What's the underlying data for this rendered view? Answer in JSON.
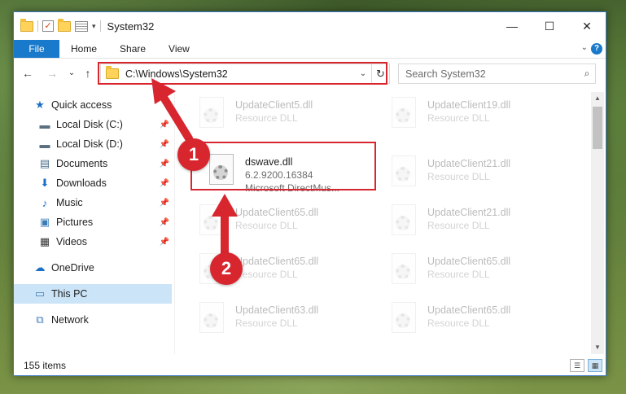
{
  "window": {
    "title": "System32",
    "controls": {
      "minimize": "—",
      "maximize": "☐",
      "close": "✕"
    }
  },
  "ribbon": {
    "tabs": [
      "File",
      "Home",
      "Share",
      "View"
    ],
    "expand_glyph": "⌄",
    "help_glyph": "?"
  },
  "nav": {
    "back_glyph": "←",
    "forward_glyph": "→",
    "recent_glyph": "⌄",
    "up_glyph": "↑"
  },
  "address": {
    "path": "C:\\Windows\\System32",
    "dropdown_glyph": "⌄",
    "refresh_glyph": "↻"
  },
  "search": {
    "placeholder": "Search System32",
    "icon_glyph": "⌕"
  },
  "sidebar": {
    "pin_glyph": "📌",
    "items": [
      {
        "label": "Quick access",
        "icon": "star-icon",
        "glyph": "★",
        "color": "#1e6fc6",
        "pinned": false
      },
      {
        "label": "Local Disk (C:)",
        "icon": "drive-icon",
        "glyph": "▬",
        "color": "#5a6f80",
        "pinned": true
      },
      {
        "label": "Local Disk (D:)",
        "icon": "drive-icon",
        "glyph": "▬",
        "color": "#5a6f80",
        "pinned": true
      },
      {
        "label": "Documents",
        "icon": "documents-icon",
        "glyph": "▤",
        "color": "#4a6c8c",
        "pinned": true
      },
      {
        "label": "Downloads",
        "icon": "download-icon",
        "glyph": "⬇",
        "color": "#1e6fc6",
        "pinned": true
      },
      {
        "label": "Music",
        "icon": "music-icon",
        "glyph": "♪",
        "color": "#1e6fc6",
        "pinned": true
      },
      {
        "label": "Pictures",
        "icon": "pictures-icon",
        "glyph": "▣",
        "color": "#3c7db8",
        "pinned": true
      },
      {
        "label": "Videos",
        "icon": "video-icon",
        "glyph": "▦",
        "color": "#333333",
        "pinned": true
      },
      {
        "label": "OneDrive",
        "icon": "cloud-icon",
        "glyph": "☁",
        "color": "#1e6fc6",
        "pinned": false
      },
      {
        "label": "This PC",
        "icon": "computer-icon",
        "glyph": "▭",
        "color": "#3c7db8",
        "pinned": false,
        "selected": true
      },
      {
        "label": "Network",
        "icon": "network-icon",
        "glyph": "⧉",
        "color": "#3c7db8",
        "pinned": false
      }
    ]
  },
  "files": {
    "highlighted": {
      "name": "dswave.dll",
      "version": "6.2.9200.16384",
      "description": "Microsoft DirectMus..."
    },
    "background": [
      {
        "name": "UpdateClient5.dll",
        "type": "Resource DLL"
      },
      {
        "name": "UpdateClient19.dll",
        "type": "Resource DLL"
      },
      {
        "name": "UpdateClient21.dll",
        "type": "Resource DLL"
      },
      {
        "name": "UpdateClient65.dll",
        "type": "Resource DLL"
      },
      {
        "name": "UpdateClient21.dll",
        "type": "Resource DLL"
      },
      {
        "name": "UpdateClient65.dll",
        "type": "Resource DLL"
      },
      {
        "name": "UpdateClient65.dll",
        "type": "Resource DLL"
      },
      {
        "name": "UpdateClient63.dll",
        "type": "Resource DLL"
      },
      {
        "name": "UpdateClient65.dll",
        "type": "Resource DLL"
      }
    ]
  },
  "status": {
    "items_count": "155 items",
    "details_view_glyph": "☰",
    "tiles_view_glyph": "▦"
  },
  "annotations": {
    "step1": "1",
    "step2": "2",
    "color": "#d8262f"
  }
}
